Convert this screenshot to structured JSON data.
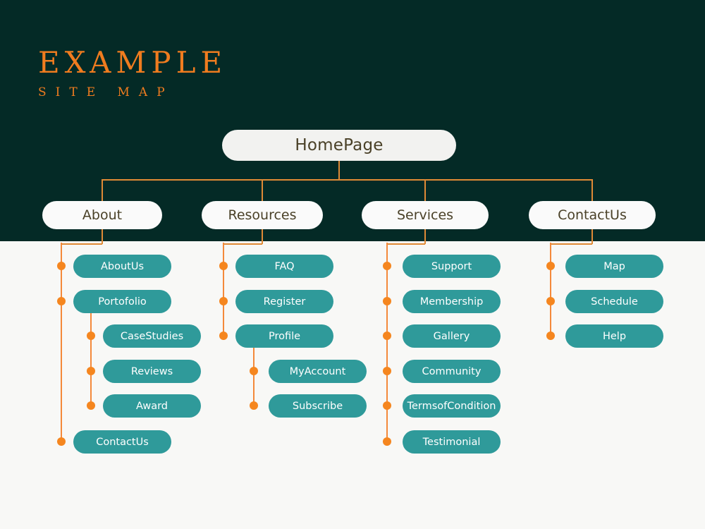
{
  "logo": {
    "title": "EXAMPLE",
    "subtitle": "SITE MAP"
  },
  "colors": {
    "dark_background": "#042a26",
    "light_background": "#f8f8f6",
    "accent_orange": "#f5861f",
    "connector_orange": "#e08a36",
    "node_teal": "#2f9a9a",
    "node_white": "#fafafa",
    "node_text_dark": "#4a4128",
    "node_text_light": "#ffffff"
  },
  "chart_data": {
    "type": "diagram",
    "title": "EXAMPLE SITE MAP",
    "root": "HomePage",
    "branches": [
      {
        "label": "About",
        "children": [
          {
            "label": "AboutUs",
            "children": []
          },
          {
            "label": "Portofolio",
            "children": [
              {
                "label": "CaseStudies"
              },
              {
                "label": "Reviews"
              },
              {
                "label": "Award"
              }
            ]
          },
          {
            "label": "ContactUs",
            "children": []
          }
        ]
      },
      {
        "label": "Resources",
        "children": [
          {
            "label": "FAQ",
            "children": []
          },
          {
            "label": "Register",
            "children": []
          },
          {
            "label": "Profile",
            "children": [
              {
                "label": "MyAccount"
              },
              {
                "label": "Subscribe"
              }
            ]
          }
        ]
      },
      {
        "label": "Services",
        "children": [
          {
            "label": "Support",
            "children": []
          },
          {
            "label": "Membership",
            "children": []
          },
          {
            "label": "Gallery",
            "children": []
          },
          {
            "label": "Community",
            "children": []
          },
          {
            "label": "TermsofCondition",
            "children": []
          },
          {
            "label": "Testimonial",
            "children": []
          }
        ]
      },
      {
        "label": "ContactUs",
        "children": [
          {
            "label": "Map",
            "children": []
          },
          {
            "label": "Schedule",
            "children": []
          },
          {
            "label": "Help",
            "children": []
          }
        ]
      }
    ]
  },
  "nodes": {
    "root": "HomePage",
    "level2": [
      "About",
      "Resources",
      "Services",
      "ContactUs"
    ],
    "about": {
      "aboutus": "AboutUs",
      "portofolio": "Portofolio",
      "casestudies": "CaseStudies",
      "reviews": "Reviews",
      "award": "Award",
      "contactus": "ContactUs"
    },
    "resources": {
      "faq": "FAQ",
      "register": "Register",
      "profile": "Profile",
      "myaccount": "MyAccount",
      "subscribe": "Subscribe"
    },
    "services": {
      "support": "Support",
      "membership": "Membership",
      "gallery": "Gallery",
      "community": "Community",
      "terms": "TermsofCondition",
      "testimonial": "Testimonial"
    },
    "contact": {
      "map": "Map",
      "schedule": "Schedule",
      "help": "Help"
    }
  }
}
